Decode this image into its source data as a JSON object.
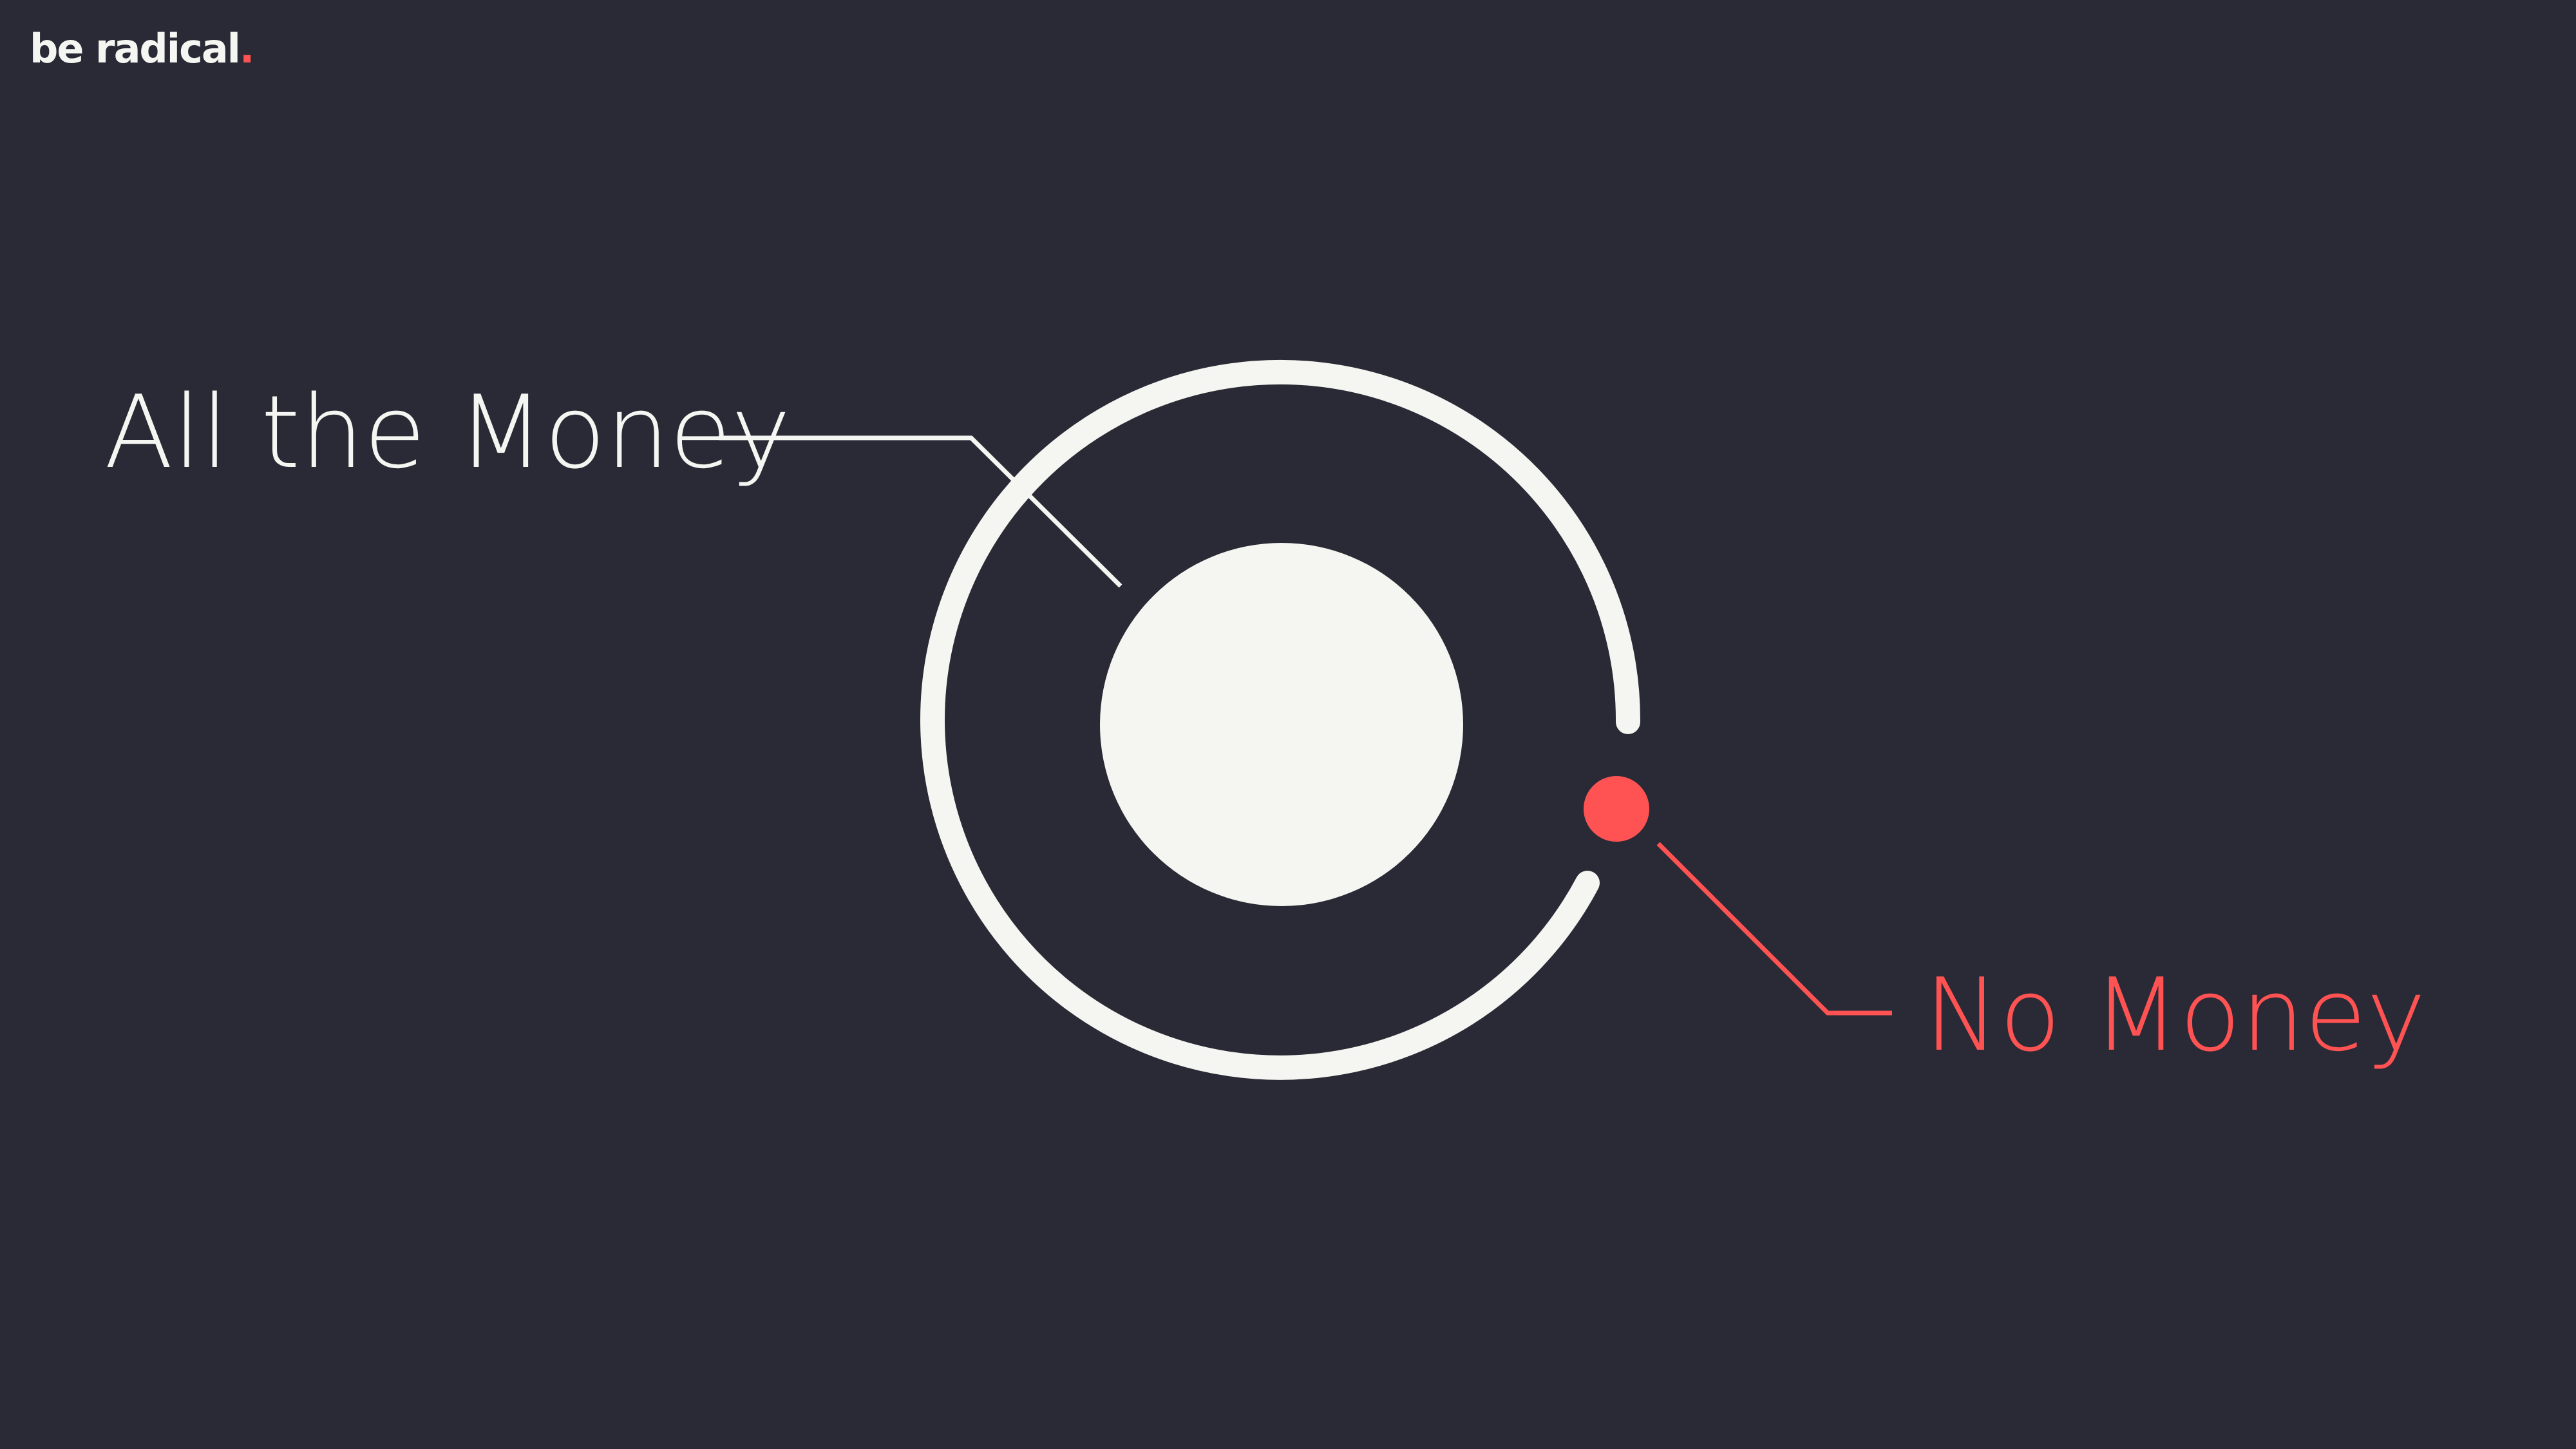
{
  "logo": {
    "text": "be radical",
    "dot": "."
  },
  "labels": {
    "all_money": "All the Money",
    "no_money": "No Money"
  },
  "colors": {
    "background": "#2a2a36",
    "foreground": "#f5f6f1",
    "accent": "#ff5353"
  }
}
